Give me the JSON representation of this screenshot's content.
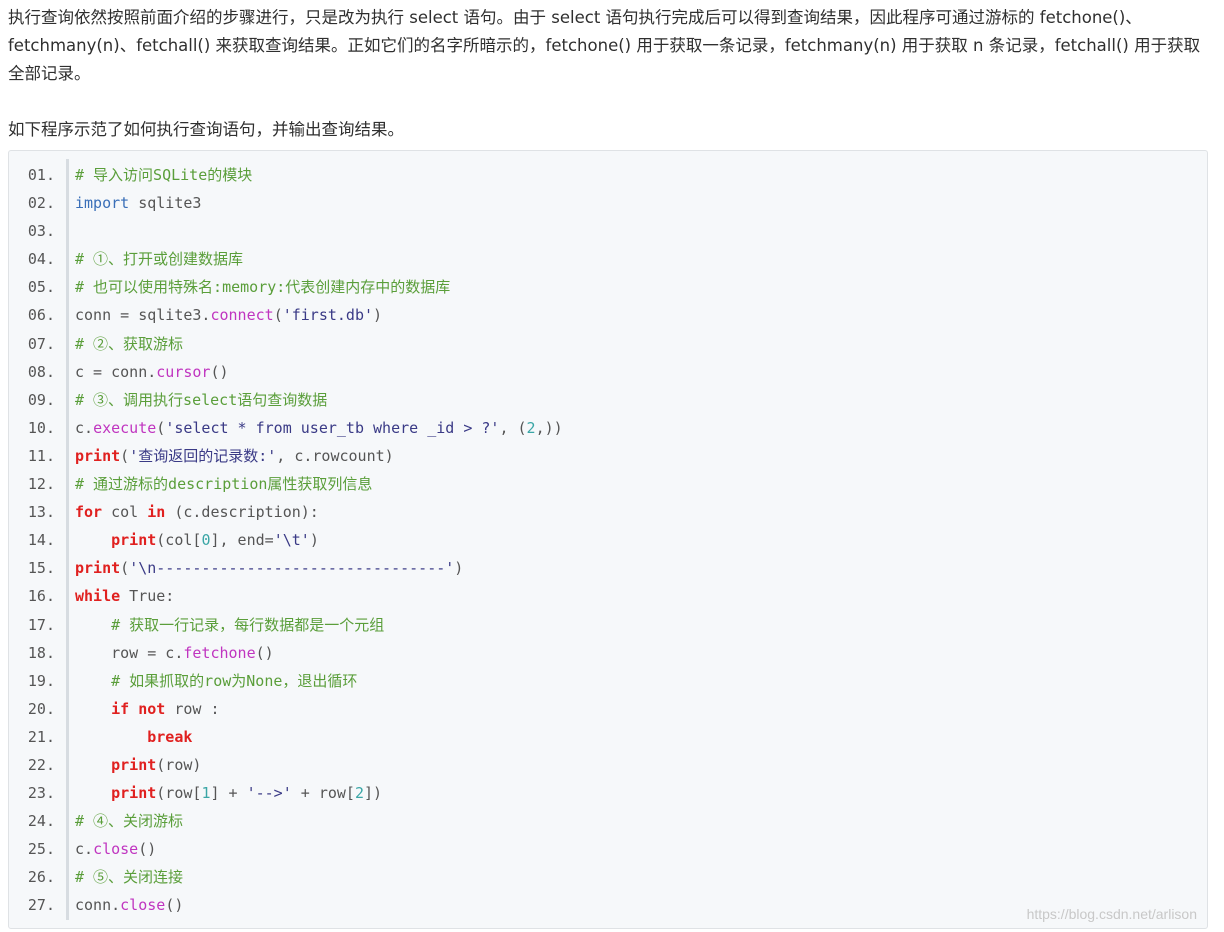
{
  "article": {
    "para1": "执行查询依然按照前面介绍的步骤进行，只是改为执行 select 语句。由于 select 语句执行完成后可以得到查询结果，因此程序可通过游标的 fetchone()、fetchmany(n)、fetchall() 来获取查询结果。正如它们的名字所暗示的，fetchone() 用于获取一条记录，fetchmany(n) 用于获取 n 条记录，fetchall() 用于获取全部记录。",
    "para2": "如下程序示范了如何执行查询语句，并输出查询结果。"
  },
  "code": {
    "lines": [
      {
        "num": "01.",
        "tokens": [
          {
            "t": "# 导入访问SQLite的模块",
            "k": "comment"
          }
        ]
      },
      {
        "num": "02.",
        "tokens": [
          {
            "t": "import",
            "k": "import"
          },
          {
            "t": " sqlite3",
            "k": "plain"
          }
        ]
      },
      {
        "num": "03.",
        "tokens": []
      },
      {
        "num": "04.",
        "tokens": [
          {
            "t": "# ①、打开或创建数据库",
            "k": "comment"
          }
        ]
      },
      {
        "num": "05.",
        "tokens": [
          {
            "t": "# 也可以使用特殊名:memory:代表创建内存中的数据库",
            "k": "comment"
          }
        ]
      },
      {
        "num": "06.",
        "tokens": [
          {
            "t": "conn = sqlite3.",
            "k": "plain"
          },
          {
            "t": "connect",
            "k": "method"
          },
          {
            "t": "(",
            "k": "plain"
          },
          {
            "t": "'first.db'",
            "k": "string"
          },
          {
            "t": ")",
            "k": "plain"
          }
        ]
      },
      {
        "num": "07.",
        "tokens": [
          {
            "t": "# ②、获取游标",
            "k": "comment"
          }
        ]
      },
      {
        "num": "08.",
        "tokens": [
          {
            "t": "c = conn.",
            "k": "plain"
          },
          {
            "t": "cursor",
            "k": "method"
          },
          {
            "t": "()",
            "k": "plain"
          }
        ]
      },
      {
        "num": "09.",
        "tokens": [
          {
            "t": "# ③、调用执行select语句查询数据",
            "k": "comment"
          }
        ]
      },
      {
        "num": "10.",
        "tokens": [
          {
            "t": "c.",
            "k": "plain"
          },
          {
            "t": "execute",
            "k": "method"
          },
          {
            "t": "(",
            "k": "plain"
          },
          {
            "t": "'select * from user_tb where _id > ?'",
            "k": "string"
          },
          {
            "t": ", (",
            "k": "plain"
          },
          {
            "t": "2",
            "k": "number"
          },
          {
            "t": ",))",
            "k": "plain"
          }
        ]
      },
      {
        "num": "11.",
        "tokens": [
          {
            "t": "print",
            "k": "keyword"
          },
          {
            "t": "(",
            "k": "plain"
          },
          {
            "t": "'查询返回的记录数:'",
            "k": "string"
          },
          {
            "t": ", c.rowcount)",
            "k": "plain"
          }
        ]
      },
      {
        "num": "12.",
        "tokens": [
          {
            "t": "# 通过游标的description属性获取列信息",
            "k": "comment"
          }
        ]
      },
      {
        "num": "13.",
        "tokens": [
          {
            "t": "for",
            "k": "keyword"
          },
          {
            "t": " col ",
            "k": "plain"
          },
          {
            "t": "in",
            "k": "keyword"
          },
          {
            "t": " (c.description):",
            "k": "plain"
          }
        ]
      },
      {
        "num": "14.",
        "tokens": [
          {
            "t": "    ",
            "k": "plain"
          },
          {
            "t": "print",
            "k": "keyword"
          },
          {
            "t": "(col[",
            "k": "plain"
          },
          {
            "t": "0",
            "k": "number"
          },
          {
            "t": "], end=",
            "k": "plain"
          },
          {
            "t": "'\\t'",
            "k": "string"
          },
          {
            "t": ")",
            "k": "plain"
          }
        ]
      },
      {
        "num": "15.",
        "tokens": [
          {
            "t": "print",
            "k": "keyword"
          },
          {
            "t": "(",
            "k": "plain"
          },
          {
            "t": "'\\n--------------------------------'",
            "k": "string"
          },
          {
            "t": ")",
            "k": "plain"
          }
        ]
      },
      {
        "num": "16.",
        "tokens": [
          {
            "t": "while",
            "k": "keyword"
          },
          {
            "t": " True:",
            "k": "plain"
          }
        ]
      },
      {
        "num": "17.",
        "tokens": [
          {
            "t": "    ",
            "k": "plain"
          },
          {
            "t": "# 获取一行记录，每行数据都是一个元组",
            "k": "comment"
          }
        ]
      },
      {
        "num": "18.",
        "tokens": [
          {
            "t": "    row = c.",
            "k": "plain"
          },
          {
            "t": "fetchone",
            "k": "method"
          },
          {
            "t": "()",
            "k": "plain"
          }
        ]
      },
      {
        "num": "19.",
        "tokens": [
          {
            "t": "    ",
            "k": "plain"
          },
          {
            "t": "# 如果抓取的row为None，退出循环",
            "k": "comment"
          }
        ]
      },
      {
        "num": "20.",
        "tokens": [
          {
            "t": "    ",
            "k": "plain"
          },
          {
            "t": "if",
            "k": "keyword"
          },
          {
            "t": " ",
            "k": "plain"
          },
          {
            "t": "not",
            "k": "keyword"
          },
          {
            "t": " row :",
            "k": "plain"
          }
        ]
      },
      {
        "num": "21.",
        "tokens": [
          {
            "t": "        ",
            "k": "plain"
          },
          {
            "t": "break",
            "k": "keyword"
          }
        ]
      },
      {
        "num": "22.",
        "tokens": [
          {
            "t": "    ",
            "k": "plain"
          },
          {
            "t": "print",
            "k": "keyword"
          },
          {
            "t": "(row)",
            "k": "plain"
          }
        ]
      },
      {
        "num": "23.",
        "tokens": [
          {
            "t": "    ",
            "k": "plain"
          },
          {
            "t": "print",
            "k": "keyword"
          },
          {
            "t": "(row[",
            "k": "plain"
          },
          {
            "t": "1",
            "k": "number"
          },
          {
            "t": "] + ",
            "k": "plain"
          },
          {
            "t": "'-->'",
            "k": "string"
          },
          {
            "t": " + row[",
            "k": "plain"
          },
          {
            "t": "2",
            "k": "number"
          },
          {
            "t": "])",
            "k": "plain"
          }
        ]
      },
      {
        "num": "24.",
        "tokens": [
          {
            "t": "# ④、关闭游标",
            "k": "comment"
          }
        ]
      },
      {
        "num": "25.",
        "tokens": [
          {
            "t": "c.",
            "k": "plain"
          },
          {
            "t": "close",
            "k": "method"
          },
          {
            "t": "()",
            "k": "plain"
          }
        ]
      },
      {
        "num": "26.",
        "tokens": [
          {
            "t": "# ⑤、关闭连接",
            "k": "comment"
          }
        ]
      },
      {
        "num": "27.",
        "tokens": [
          {
            "t": "conn.",
            "k": "plain"
          },
          {
            "t": "close",
            "k": "method"
          },
          {
            "t": "()",
            "k": "plain"
          }
        ]
      }
    ]
  },
  "watermark": "https://blog.csdn.net/arlison"
}
